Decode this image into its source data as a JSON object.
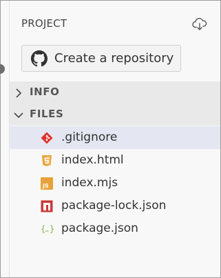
{
  "panel": {
    "title": "PROJECT",
    "cloud_icon": "cloud-download-icon"
  },
  "repo_button": {
    "label": "Create a repository",
    "icon": "github-icon"
  },
  "sections": [
    {
      "label": "INFO",
      "expanded": false
    },
    {
      "label": "FILES",
      "expanded": true
    }
  ],
  "files": [
    {
      "name": ".gitignore",
      "icon": "git-icon",
      "color": "#e0322a",
      "selected": true
    },
    {
      "name": "index.html",
      "icon": "html5-icon",
      "color": "#e8a23a",
      "selected": false
    },
    {
      "name": "index.mjs",
      "icon": "javascript-icon",
      "color": "#e8a23a",
      "selected": false
    },
    {
      "name": "package-lock.json",
      "icon": "npm-icon",
      "color": "#cb3837",
      "selected": false
    },
    {
      "name": "package.json",
      "icon": "json-icon",
      "color": "#8bb24a",
      "selected": false
    }
  ],
  "colors": {
    "background": "#f8f8f8",
    "section_background": "#e9e9e9",
    "selected_row": "#e4e6f1"
  }
}
